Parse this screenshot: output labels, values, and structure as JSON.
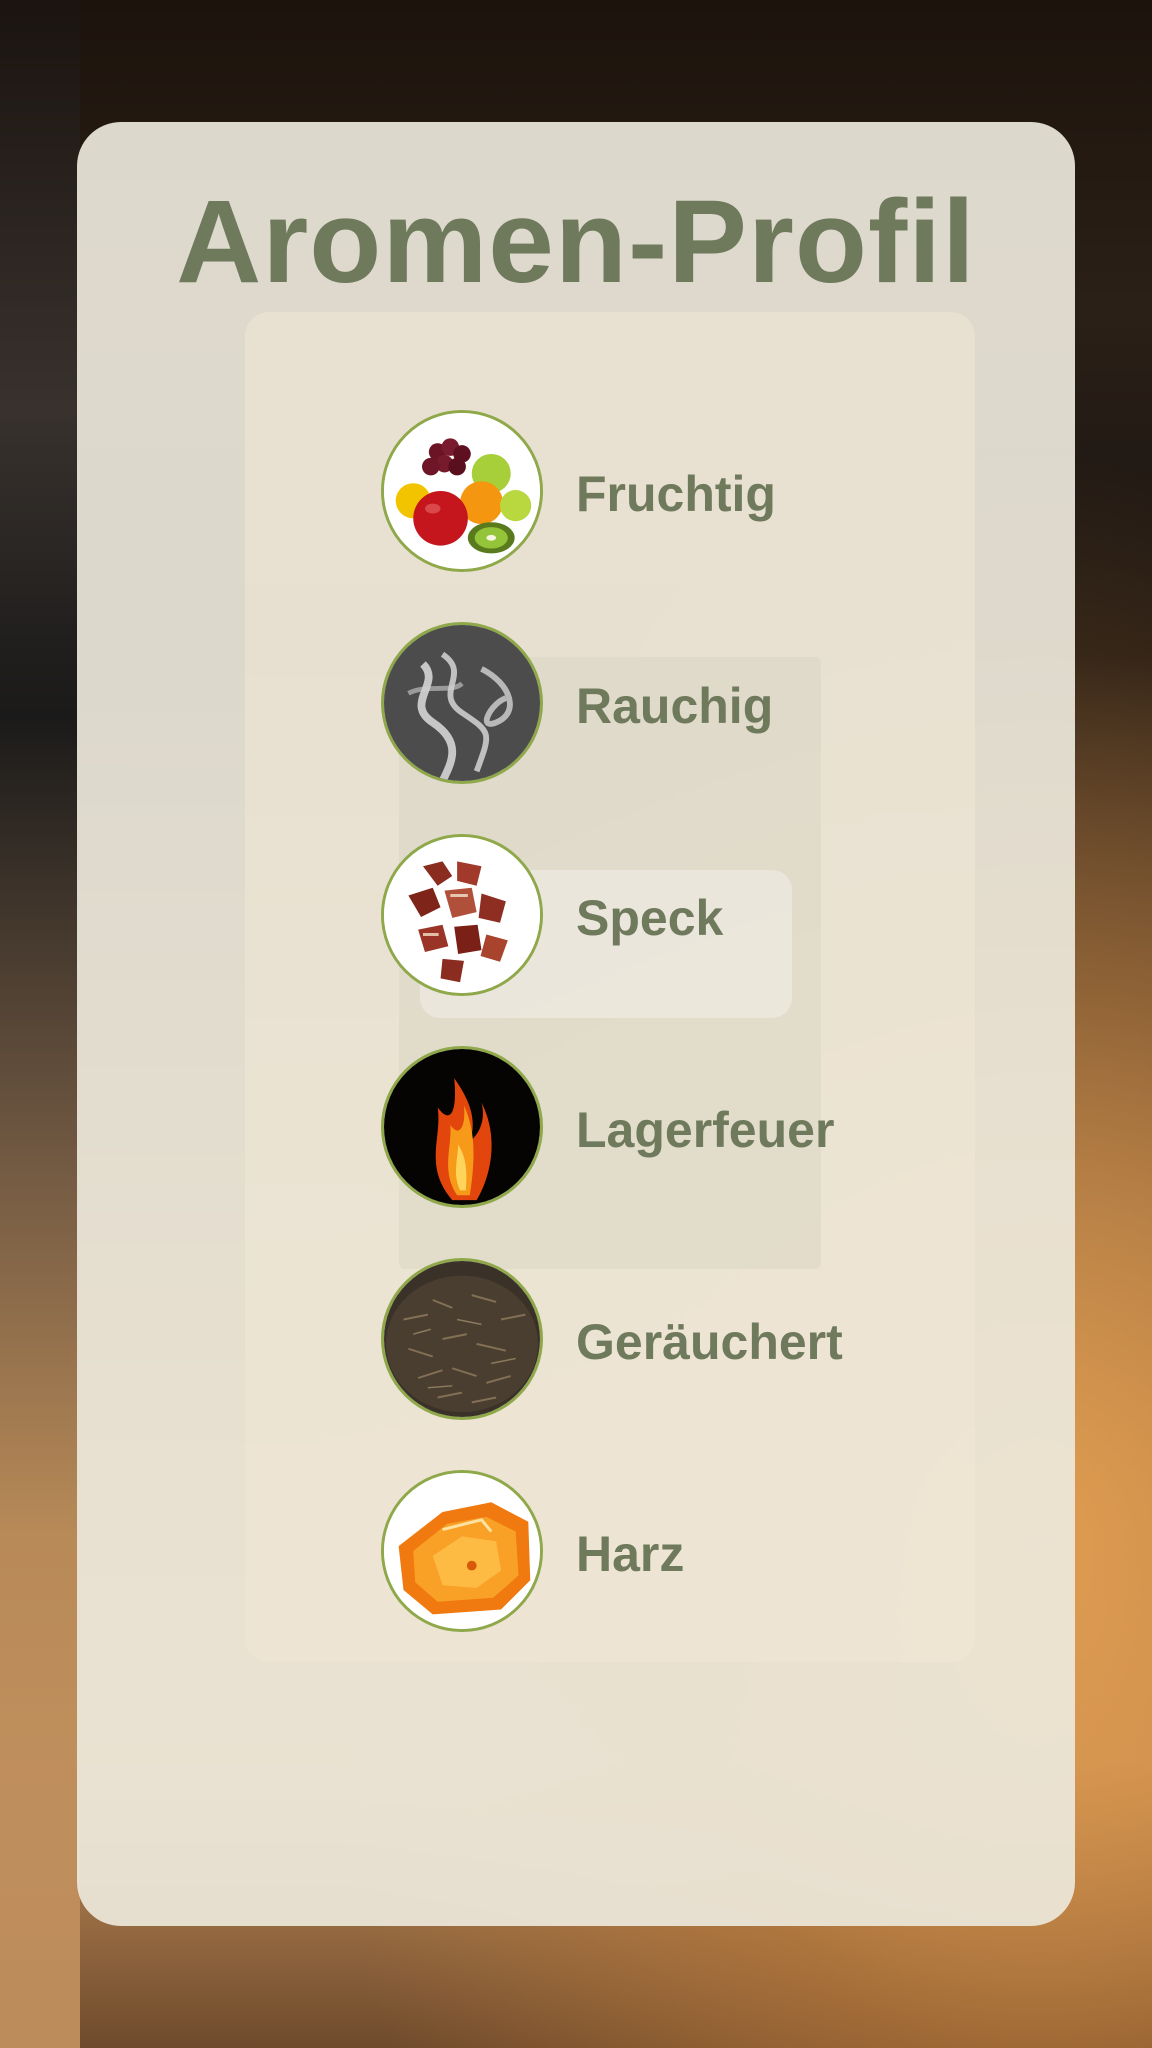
{
  "panel": {
    "title": "Aromen-Profil"
  },
  "aromas": [
    {
      "label": "Fruchtig",
      "icon": "fruit-icon"
    },
    {
      "label": "Rauchig",
      "icon": "smoke-icon"
    },
    {
      "label": "Speck",
      "icon": "bacon-icon"
    },
    {
      "label": "Lagerfeuer",
      "icon": "campfire-icon"
    },
    {
      "label": "Geräuchert",
      "icon": "smoked-tea-icon"
    },
    {
      "label": "Harz",
      "icon": "resin-icon"
    }
  ],
  "colors": {
    "text": "#6f7a5d",
    "ring": "#8fa84a",
    "card": "#ece7da"
  }
}
